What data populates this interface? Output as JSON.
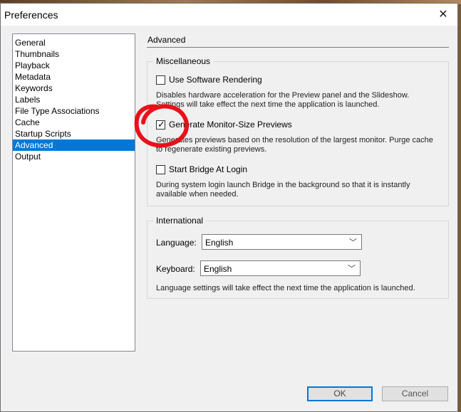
{
  "window": {
    "title": "Preferences",
    "close_glyph": "✕"
  },
  "nav": {
    "items": [
      {
        "label": "General"
      },
      {
        "label": "Thumbnails"
      },
      {
        "label": "Playback"
      },
      {
        "label": "Metadata"
      },
      {
        "label": "Keywords"
      },
      {
        "label": "Labels"
      },
      {
        "label": "File Type Associations"
      },
      {
        "label": "Cache"
      },
      {
        "label": "Startup Scripts"
      },
      {
        "label": "Advanced",
        "selected": true
      },
      {
        "label": "Output"
      }
    ]
  },
  "panel": {
    "heading": "Advanced",
    "misc": {
      "title": "Miscellaneous",
      "software_rendering": {
        "label": "Use Software Rendering",
        "checked": false,
        "desc": "Disables hardware acceleration for the Preview panel and the Slideshow. Settings will take effect the next time the application is launched."
      },
      "monitor_previews": {
        "label": "Generate Monitor-Size Previews",
        "checked": true,
        "check_glyph": "✓",
        "desc": "Generates previews based on the resolution of the largest monitor.  Purge cache to regenerate existing previews."
      },
      "start_bridge": {
        "label": "Start Bridge At Login",
        "checked": false,
        "desc": "During system login launch Bridge in the background so that it is instantly available when needed."
      }
    },
    "intl": {
      "title": "International",
      "language": {
        "label": "Language:",
        "value": "English"
      },
      "keyboard": {
        "label": "Keyboard:",
        "value": "English"
      },
      "note": "Language settings will take effect the next time the application is launched.",
      "caret_glyph": "﹀"
    }
  },
  "buttons": {
    "ok": "OK",
    "cancel": "Cancel"
  },
  "colors": {
    "selection": "#0078d7",
    "annotation": "#e8101a"
  }
}
